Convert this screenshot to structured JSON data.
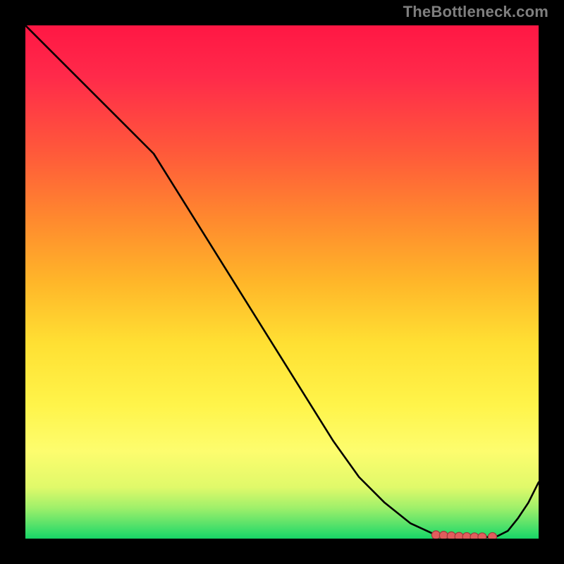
{
  "watermark": "TheBottleneck.com",
  "colors": {
    "curve": "#000000",
    "marker_fill": "#e15d5d",
    "marker_stroke": "#9c3b3b",
    "gradient_top": "#ff1744",
    "gradient_bottom": "#18d466",
    "background": "#000000"
  },
  "chart_data": {
    "type": "line",
    "title": "",
    "xlabel": "",
    "ylabel": "",
    "xlim": [
      0,
      100
    ],
    "ylim": [
      0,
      100
    ],
    "grid": false,
    "legend": false,
    "series": [
      {
        "name": "bottleneck-curve",
        "x": [
          0,
          5,
          10,
          15,
          20,
          25,
          30,
          35,
          40,
          45,
          50,
          55,
          60,
          65,
          70,
          75,
          80,
          82,
          84,
          86,
          88,
          90,
          92,
          94,
          96,
          98,
          100
        ],
        "y": [
          100,
          95,
          90,
          85,
          80,
          75,
          67,
          59,
          51,
          43,
          35,
          27,
          19,
          12,
          7,
          3,
          0.7,
          0.4,
          0.3,
          0.3,
          0.3,
          0.3,
          0.5,
          1.5,
          4,
          7,
          11
        ]
      }
    ],
    "markers": {
      "series": "bottleneck-curve",
      "x": [
        80,
        81.5,
        83,
        84.5,
        86,
        87.5,
        89,
        91
      ],
      "y": [
        0.7,
        0.6,
        0.5,
        0.4,
        0.35,
        0.3,
        0.3,
        0.35
      ],
      "size": 6
    },
    "annotations": []
  }
}
